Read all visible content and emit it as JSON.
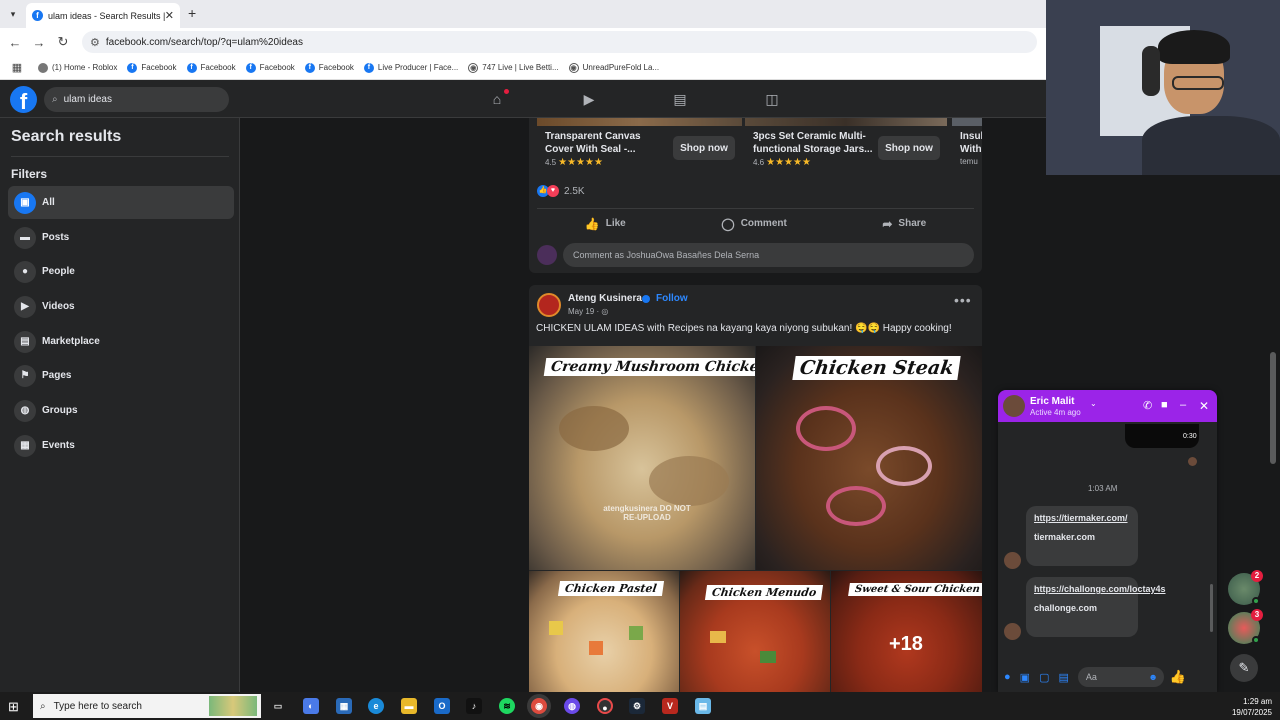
{
  "browser": {
    "tab_title": "ulam ideas - Search Results | Fa",
    "url": "facebook.com/search/top/?q=ulam%20ideas",
    "bookmarks": [
      {
        "icon": "roblox-icon",
        "label": "(1) Home - Roblox"
      },
      {
        "icon": "facebook-icon",
        "label": "Facebook"
      },
      {
        "icon": "facebook-icon",
        "label": "Facebook"
      },
      {
        "icon": "facebook-icon",
        "label": "Facebook"
      },
      {
        "icon": "facebook-icon",
        "label": "Facebook"
      },
      {
        "icon": "facebook-icon",
        "label": "Live Producer | Face..."
      },
      {
        "icon": "globe-icon",
        "label": "747 Live | Live Betti..."
      },
      {
        "icon": "globe-icon",
        "label": "UnreadPureFold La..."
      }
    ]
  },
  "fb": {
    "search_value": "ulam ideas",
    "accent": "#1877f2"
  },
  "sidebar": {
    "title": "Search results",
    "filters_title": "Filters",
    "items": [
      {
        "label": "All",
        "icon": "all-icon",
        "active": true
      },
      {
        "label": "Posts",
        "icon": "posts-icon"
      },
      {
        "label": "People",
        "icon": "people-icon"
      },
      {
        "label": "Videos",
        "icon": "videos-icon"
      },
      {
        "label": "Marketplace",
        "icon": "marketplace-icon"
      },
      {
        "label": "Pages",
        "icon": "pages-icon"
      },
      {
        "label": "Groups",
        "icon": "groups-icon"
      },
      {
        "label": "Events",
        "icon": "events-icon"
      }
    ]
  },
  "ad_post": {
    "products": [
      {
        "title": "Transparent Canvas Cover With Seal -...",
        "rating": "4.5",
        "stars": "★★★★★",
        "cta": "Shop now"
      },
      {
        "title": "3pcs Set Ceramic Multi-functional Storage Jars...",
        "rating": "4.6",
        "stars": "★★★★★",
        "cta": "Shop now"
      },
      {
        "title": "Insul With",
        "sub": "temu"
      }
    ],
    "reaction_count": "2.5K",
    "like": "Like",
    "comment": "Comment",
    "share": "Share",
    "comment_placeholder": "Comment as JoshuaOwa Basañes Dela Serna"
  },
  "post": {
    "author": "Ateng Kusinera",
    "follow": "Follow",
    "date": "May 19 · ",
    "text": "CHICKEN ULAM IDEAS with Recipes na kayang kaya niyong subukan! 🤤🤤 Happy cooking!",
    "images": [
      {
        "label": "Creamy Mushroom Chicken",
        "watermark": "atengkusinera DO NOT RE-UPLOAD"
      },
      {
        "label": "Chicken Steak"
      },
      {
        "label": "Chicken Pastel"
      },
      {
        "label": "Chicken Menudo"
      },
      {
        "label": "Sweet & Sour Chicken",
        "more": "+18"
      }
    ]
  },
  "chat": {
    "name": "Eric Malit",
    "status": "Active 4m ago",
    "voice_duration": "0:30",
    "timestamp": "1:03 AM",
    "messages": [
      {
        "link": "https://tiermaker.com/",
        "domain": "tiermaker.com"
      },
      {
        "link": "https://challonge.com/loctay4s",
        "domain": "challonge.com"
      }
    ],
    "composer_placeholder": "Aa",
    "header_color": "#9b24e8"
  },
  "bubbles": [
    {
      "badge": "2"
    },
    {
      "badge": "3"
    }
  ],
  "taskbar": {
    "search_placeholder": "Type here to search",
    "time": "1:29 am",
    "date": "19/07/2025"
  }
}
